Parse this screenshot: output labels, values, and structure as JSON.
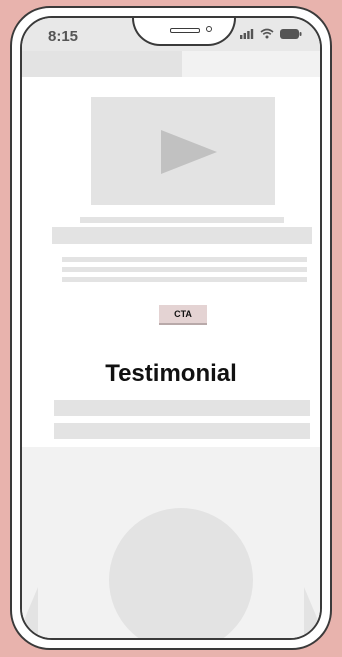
{
  "status_bar": {
    "time": "8:15",
    "icons": [
      "signal-icon",
      "wifi-icon",
      "battery-icon"
    ]
  },
  "hero": {
    "media_icon": "play-icon",
    "cta_label": "CTA"
  },
  "testimonial": {
    "heading": "Testimonial"
  },
  "colors": {
    "background": "#e8b3ad",
    "placeholder": "#e3e3e3",
    "cta_fill": "#e4d3d3",
    "frame": "#3a3a3a"
  }
}
